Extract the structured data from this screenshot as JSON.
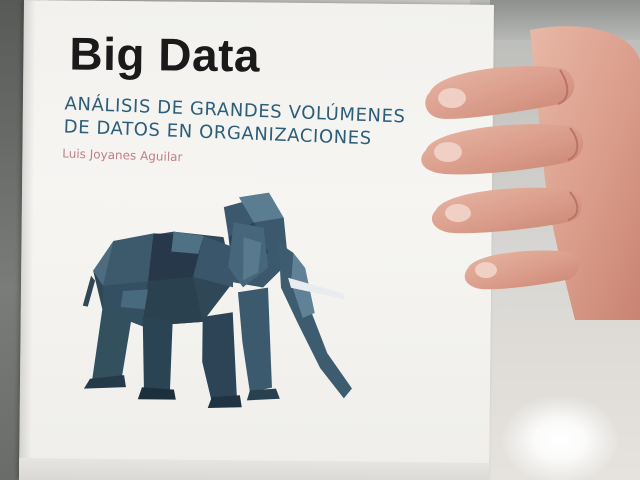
{
  "book": {
    "title": "Big Data",
    "subtitle_line1": "ANÁLISIS DE GRANDES VOLÚMENES",
    "subtitle_line2": "DE DATOS EN ORGANIZACIONES",
    "author": "Luis Joyanes Aguilar",
    "title_color": "#1a1a1a",
    "subtitle_color": "#2c5e7a",
    "author_color": "#c07f84"
  },
  "scene": {
    "illustration": "low-poly-elephant",
    "object": "book-cover-held-by-hand"
  }
}
